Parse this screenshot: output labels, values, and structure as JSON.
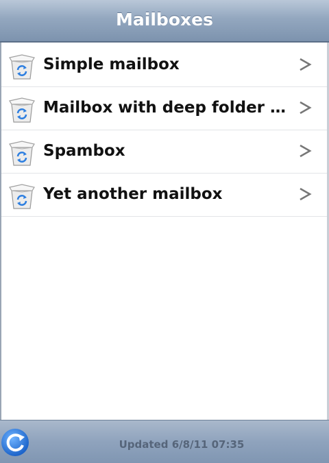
{
  "header": {
    "title": "Mailboxes"
  },
  "mailboxes": [
    {
      "label": "Simple mailbox",
      "icon": "mailbox-icon"
    },
    {
      "label": "Mailbox with deep folder hierarchy",
      "icon": "mailbox-icon"
    },
    {
      "label": "Spambox",
      "icon": "mailbox-icon"
    },
    {
      "label": "Yet another mailbox",
      "icon": "mailbox-icon"
    }
  ],
  "footer": {
    "updated_text": "Updated  6/8/11  07:35",
    "refresh_icon": "refresh-icon"
  },
  "colors": {
    "header_top": "#b9c7d8",
    "header_bottom": "#7d93ae",
    "icon_blue": "#2e7fe0",
    "chevron": "#777777"
  }
}
